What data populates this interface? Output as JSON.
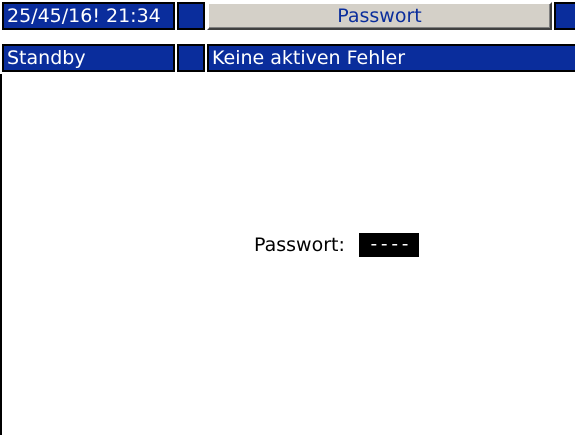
{
  "header": {
    "datetime": "25/45/16! 21:34",
    "screen_title": "Passwort"
  },
  "status_bar": {
    "state": "Standby",
    "message": "Keine aktiven Fehler"
  },
  "password_form": {
    "label": "Passwort:",
    "value": "----"
  },
  "colors": {
    "bar_blue": "#0a2d9c",
    "title_gray": "#d4d0c8",
    "background": "#ffffff",
    "field_bg": "#000000"
  }
}
